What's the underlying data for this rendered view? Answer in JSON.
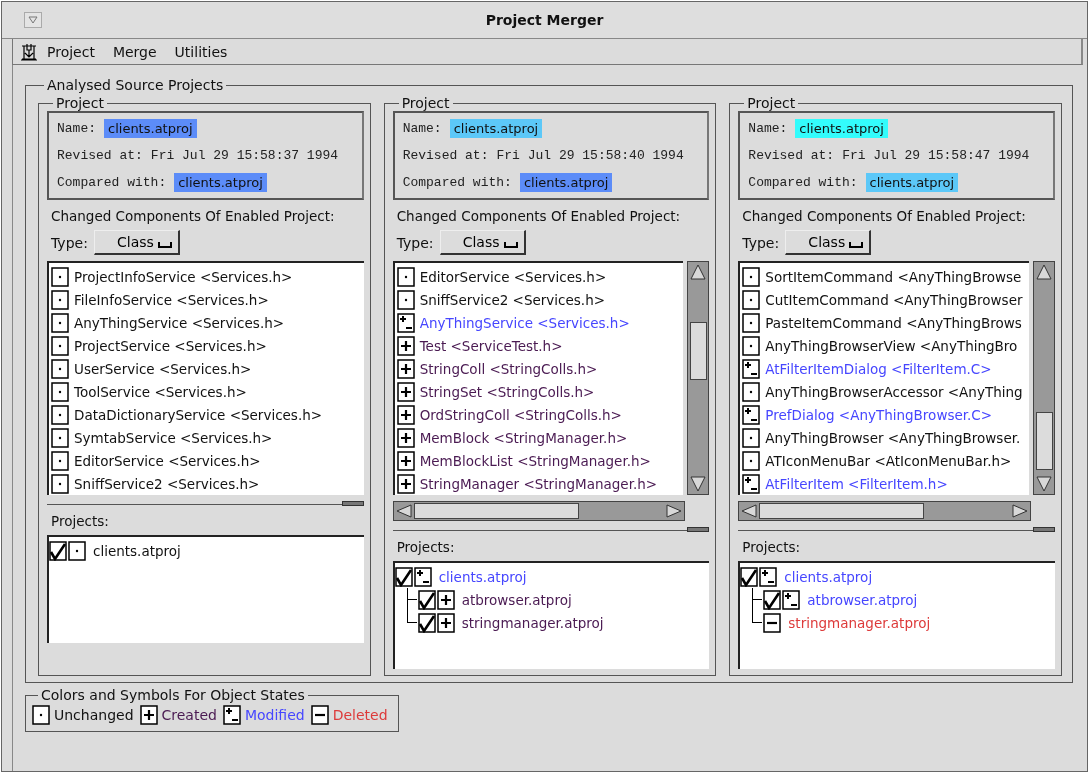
{
  "window": {
    "title": "Project Merger"
  },
  "menu": [
    "Project",
    "Merge",
    "Utilities"
  ],
  "group_title": "Analysed Source Projects",
  "projects": [
    {
      "title": "Project",
      "name_label": "Name:",
      "name": {
        "text": "clients.atproj",
        "color": "#5c8cf8"
      },
      "revised_label": "Revised at:",
      "revised": "Fri Jul 29 15:58:37 1994",
      "compared_label": "Compared with:",
      "compared": {
        "text": "clients.atproj",
        "color": "#5c8cf8"
      },
      "components_label": "Changed Components Of Enabled Project:",
      "type_label": "Type:",
      "type_value": "Class",
      "scrollbars": false,
      "components": [
        {
          "name": "ProjectInfoService <Services.h>",
          "kind": "unchanged"
        },
        {
          "name": "FileInfoService <Services.h>",
          "kind": "unchanged"
        },
        {
          "name": "AnyThingService <Services.h>",
          "kind": "unchanged"
        },
        {
          "name": "ProjectService <Services.h>",
          "kind": "unchanged"
        },
        {
          "name": "UserService <Services.h>",
          "kind": "unchanged"
        },
        {
          "name": "ToolService <Services.h>",
          "kind": "unchanged"
        },
        {
          "name": "DataDictionaryService <Services.h>",
          "kind": "unchanged"
        },
        {
          "name": "SymtabService <Services.h>",
          "kind": "unchanged"
        },
        {
          "name": "EditorService <Services.h>",
          "kind": "unchanged"
        },
        {
          "name": "SniffService2 <Services.h>",
          "kind": "unchanged"
        }
      ],
      "projects_label": "Projects:",
      "tree": [
        {
          "name": "clients.atproj",
          "kind": "unchanged",
          "checked": true
        }
      ]
    },
    {
      "title": "Project",
      "name_label": "Name:",
      "name": {
        "text": "clients.atproj",
        "color": "#5cc8f8"
      },
      "revised_label": "Revised at:",
      "revised": "Fri Jul 29 15:58:40 1994",
      "compared_label": "Compared with:",
      "compared": {
        "text": "clients.atproj",
        "color": "#5c8cf8"
      },
      "components_label": "Changed Components Of Enabled Project:",
      "type_label": "Type:",
      "type_value": "Class",
      "scrollbars": true,
      "components": [
        {
          "name": "EditorService <Services.h>",
          "kind": "unchanged"
        },
        {
          "name": "SniffService2 <Services.h>",
          "kind": "unchanged"
        },
        {
          "name": "AnyThingService <Services.h>",
          "kind": "modified"
        },
        {
          "name": "Test <ServiceTest.h>",
          "kind": "created"
        },
        {
          "name": "StringColl <StringColls.h>",
          "kind": "created"
        },
        {
          "name": "StringSet <StringColls.h>",
          "kind": "created"
        },
        {
          "name": "OrdStringColl <StringColls.h>",
          "kind": "created"
        },
        {
          "name": "MemBlock <StringManager.h>",
          "kind": "created"
        },
        {
          "name": "MemBlockList <StringManager.h>",
          "kind": "created"
        },
        {
          "name": "StringManager <StringManager.h>",
          "kind": "created"
        }
      ],
      "projects_label": "Projects:",
      "tree": [
        {
          "name": "clients.atproj",
          "kind": "modified",
          "checked": true,
          "children": [
            {
              "name": "atbrowser.atproj",
              "kind": "created",
              "checked": true
            },
            {
              "name": "stringmanager.atproj",
              "kind": "created",
              "checked": true
            }
          ]
        }
      ]
    },
    {
      "title": "Project",
      "name_label": "Name:",
      "name": {
        "text": "clients.atproj",
        "color": "#33fcfc"
      },
      "revised_label": "Revised at:",
      "revised": "Fri Jul 29 15:58:47 1994",
      "compared_label": "Compared with:",
      "compared": {
        "text": "clients.atproj",
        "color": "#5cc8f8"
      },
      "components_label": "Changed Components Of Enabled Project:",
      "type_label": "Type:",
      "type_value": "Class",
      "scrollbars": true,
      "components": [
        {
          "name": "SortItemCommand <AnyThingBrowse",
          "kind": "unchanged"
        },
        {
          "name": "CutItemCommand <AnyThingBrowser",
          "kind": "unchanged"
        },
        {
          "name": "PasteItemCommand <AnyThingBrows",
          "kind": "unchanged"
        },
        {
          "name": "AnyThingBrowserView <AnyThingBro",
          "kind": "unchanged"
        },
        {
          "name": "AtFilterItemDialog <FilterItem.C>",
          "kind": "modified"
        },
        {
          "name": "AnyThingBrowserAccessor <AnyThing",
          "kind": "unchanged"
        },
        {
          "name": "PrefDialog <AnyThingBrowser.C>",
          "kind": "modified"
        },
        {
          "name": "AnyThingBrowser <AnyThingBrowser.",
          "kind": "unchanged"
        },
        {
          "name": "ATIconMenuBar <AtIconMenuBar.h>",
          "kind": "unchanged"
        },
        {
          "name": "AtFilterItem <FilterItem.h>",
          "kind": "modified"
        }
      ],
      "projects_label": "Projects:",
      "tree": [
        {
          "name": "clients.atproj",
          "kind": "modified",
          "checked": true,
          "children": [
            {
              "name": "atbrowser.atproj",
              "kind": "modified",
              "checked": true
            },
            {
              "name": "stringmanager.atproj",
              "kind": "deleted"
            }
          ]
        }
      ]
    }
  ],
  "legend": {
    "title": "Colors and Symbols For Object States",
    "items": [
      {
        "kind": "unchanged",
        "label": "Unchanged"
      },
      {
        "kind": "created",
        "label": "Created"
      },
      {
        "kind": "modified",
        "label": "Modified"
      },
      {
        "kind": "deleted",
        "label": "Deleted"
      }
    ]
  }
}
